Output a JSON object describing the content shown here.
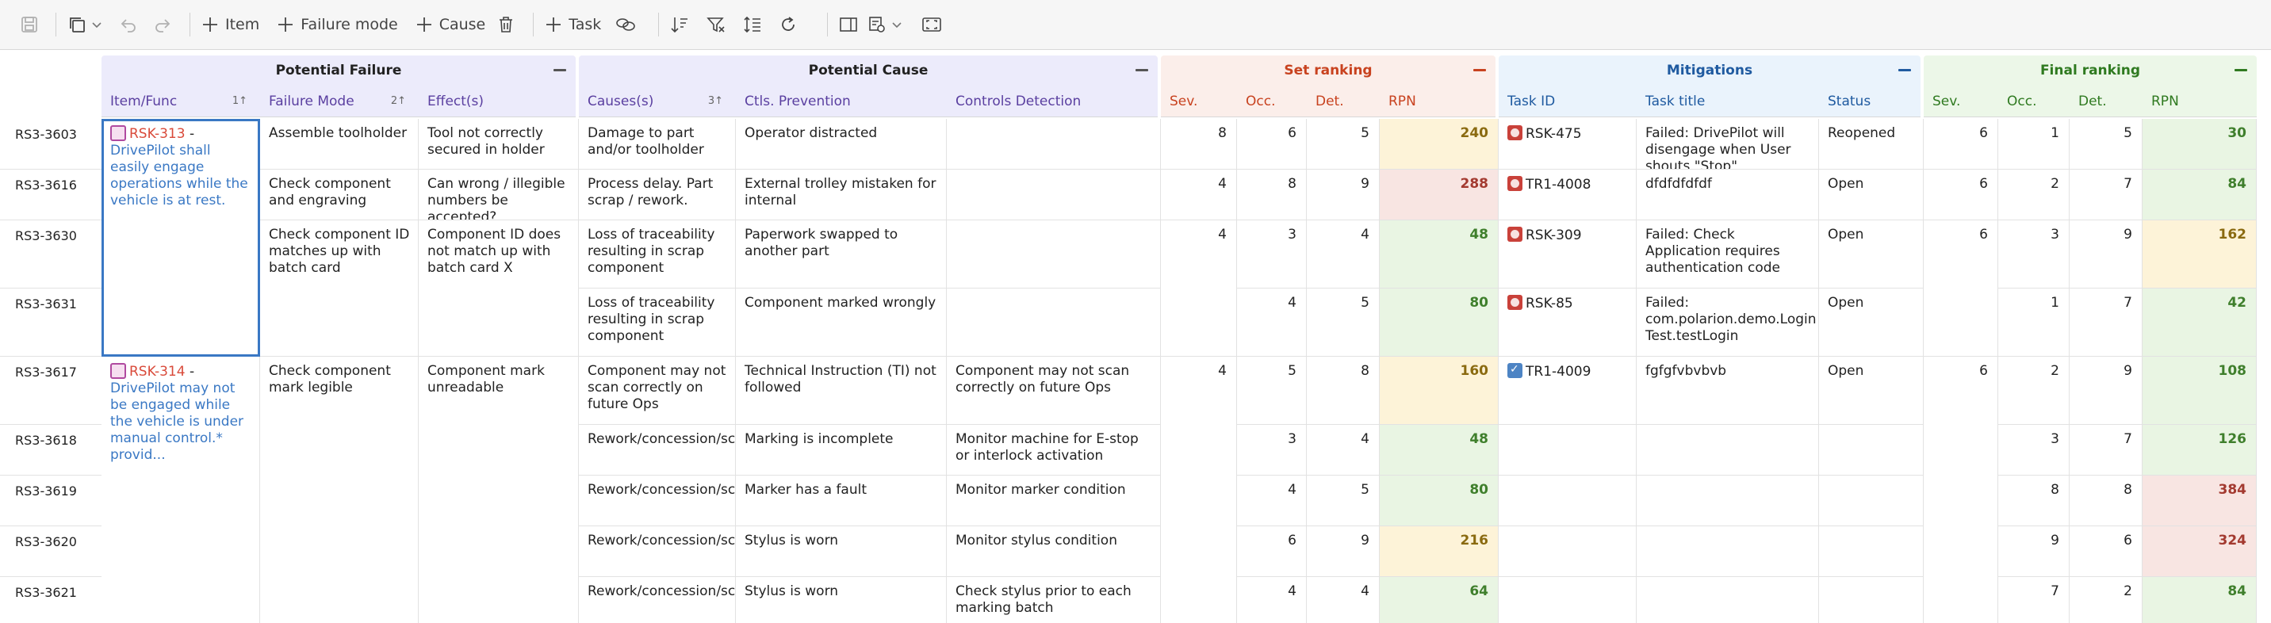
{
  "toolbar": {
    "item_label": "Item",
    "failure_mode_label": "Failure mode",
    "cause_label": "Cause",
    "task_label": "Task"
  },
  "groups": {
    "potential_failure": "Potential Failure",
    "potential_cause": "Potential Cause",
    "set_ranking": "Set ranking",
    "mitigations": "Mitigations",
    "final_ranking": "Final ranking"
  },
  "columns": {
    "item_func": "Item/Func",
    "item_func_sort": "1↑",
    "failure_mode": "Failure Mode",
    "failure_mode_sort": "2↑",
    "effects": "Effect(s)",
    "causes": "Causes(s)",
    "causes_sort": "3↑",
    "ctls_prevention": "Ctls. Prevention",
    "controls_detection": "Controls Detection",
    "sev": "Sev.",
    "occ": "Occ.",
    "det": "Det.",
    "rpn": "RPN",
    "task_id": "Task ID",
    "task_title": "Task title",
    "status": "Status",
    "final_sev": "Sev.",
    "final_occ": "Occ.",
    "final_det": "Det.",
    "final_rpn": "RPN"
  },
  "functions": [
    {
      "id": "RSK-313",
      "sep": " - ",
      "text": "DrivePilot shall easily engage operations while the vehicle is at rest."
    },
    {
      "id": "RSK-314",
      "sep": " - ",
      "text": "DrivePilot may not be engaged while the vehicle is under manual control.* provid..."
    }
  ],
  "failure_modes": [
    "Assemble toolholder",
    "Check component and engraving",
    "Check component ID matches up with batch card",
    "Check component mark legible"
  ],
  "effects": [
    "Tool not correctly secured in holder",
    "Can wrong  / illegible numbers be accepted?",
    "Component ID does not match up with batch card X",
    "Component mark unreadable"
  ],
  "rows": [
    {
      "hdr": "RS3-3603",
      "cause": "Damage to part and/or toolholder",
      "prev": "Operator distracted",
      "det_ctl": "",
      "sev": "8",
      "occ": "6",
      "det": "5",
      "rpn": "240",
      "task_id": "RSK-475",
      "task_title": "Failed: DrivePilot will disengage when User shouts \"Stop\"",
      "status": "Reopened",
      "fsev": "6",
      "focc": "1",
      "fdet": "5",
      "frpn": "30"
    },
    {
      "hdr": "RS3-3616",
      "cause": "Process delay. Part scrap / rework.",
      "prev": "External trolley mistaken for internal",
      "det_ctl": "",
      "sev": "4",
      "occ": "8",
      "det": "9",
      "rpn": "288",
      "task_id": "TR1-4008",
      "task_title": "dfdfdfdfdf",
      "status": "Open",
      "fsev": "6",
      "focc": "2",
      "fdet": "7",
      "frpn": "84"
    },
    {
      "hdr": "RS3-3630",
      "cause": "Loss of traceability resulting in scrap component",
      "prev": "Paperwork swapped to another part",
      "det_ctl": "",
      "sev": "4",
      "occ": "3",
      "det": "4",
      "rpn": "48",
      "task_id": "RSK-309",
      "task_title": "Failed: Check Application requires authentication code",
      "status": "Open",
      "fsev": "6",
      "focc": "3",
      "fdet": "9",
      "frpn": "162"
    },
    {
      "hdr": "RS3-3631",
      "cause": "Loss of traceability resulting in scrap component",
      "prev": "Component marked wrongly",
      "det_ctl": "",
      "sev": "",
      "occ": "4",
      "det": "5",
      "rpn": "80",
      "task_id": "RSK-85",
      "task_title": "Failed: com.polarion.demo.Login Test.testLogin",
      "status": "Open",
      "fsev": "",
      "focc": "1",
      "fdet": "7",
      "frpn": "42"
    },
    {
      "hdr": "RS3-3617",
      "cause": "Component may not scan correctly on future Ops",
      "prev": "Technical Instruction (TI) not followed",
      "det_ctl": "Component may not scan correctly on future Ops",
      "sev": "4",
      "occ": "5",
      "det": "8",
      "rpn": "160",
      "task_id": "TR1-4009",
      "task_title": "fgfgfvbvbvb",
      "status": "Open",
      "fsev": "6",
      "focc": "2",
      "fdet": "9",
      "frpn": "108"
    },
    {
      "hdr": "RS3-3618",
      "cause": "Rework/concession/scrap",
      "prev": "Marking is incomplete",
      "det_ctl": "Monitor machine for E-stop or interlock activation",
      "sev": "",
      "occ": "3",
      "det": "4",
      "rpn": "48",
      "task_id": "",
      "task_title": "",
      "status": "",
      "fsev": "",
      "focc": "3",
      "fdet": "7",
      "frpn": "126"
    },
    {
      "hdr": "RS3-3619",
      "cause": "Rework/concession/scrap",
      "prev": "Marker has a fault",
      "det_ctl": "Monitor marker condition",
      "sev": "",
      "occ": "4",
      "det": "5",
      "rpn": "80",
      "task_id": "",
      "task_title": "",
      "status": "",
      "fsev": "",
      "focc": "8",
      "fdet": "8",
      "frpn": "384"
    },
    {
      "hdr": "RS3-3620",
      "cause": "Rework/concession/scrap",
      "prev": "Stylus is worn",
      "det_ctl": "Monitor stylus condition",
      "sev": "",
      "occ": "6",
      "det": "9",
      "rpn": "216",
      "task_id": "",
      "task_title": "",
      "status": "",
      "fsev": "",
      "focc": "9",
      "fdet": "6",
      "frpn": "324"
    },
    {
      "hdr": "RS3-3621",
      "cause": "Rework/concession/scrap",
      "prev": "Stylus is worn",
      "det_ctl": "Check stylus prior to each marking batch",
      "sev": "",
      "occ": "4",
      "det": "4",
      "rpn": "64",
      "task_id": "",
      "task_title": "",
      "status": "",
      "fsev": "",
      "focc": "7",
      "fdet": "2",
      "frpn": "84"
    }
  ],
  "rpn_colors": {
    "green": "#e9f5e3",
    "yellow": "#fdf3d8",
    "red": "#f8e5e2"
  }
}
